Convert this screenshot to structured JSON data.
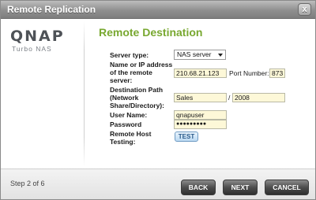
{
  "window": {
    "title": "Remote Replication",
    "close_glyph": "x"
  },
  "logo": {
    "brand": "QNAP",
    "sub": "Turbo NAS"
  },
  "heading": "Remote Destination",
  "form": {
    "server_type_label": "Server type:",
    "server_type_value": "NAS server",
    "address_label_1": "Name or IP address",
    "address_label_2": "of the remote",
    "address_label_3": "server:",
    "address_value": "210.68.21.123",
    "port_label": "Port Number:",
    "port_value": "873",
    "dest_label_1": "Destination Path",
    "dest_label_2": "(Network",
    "dest_label_3": "Share/Directory):",
    "dest_share_value": "Sales",
    "dest_separator": "/",
    "dest_dir_value": "2008",
    "username_label": "User Name:",
    "username_value": "qnapuser",
    "password_label": "Password",
    "password_value": "●●●●●●●●●",
    "remote_test_label_1": "Remote Host",
    "remote_test_label_2": "Testing:",
    "test_button": "TEST"
  },
  "footer": {
    "step": "Step 2 of 6",
    "back": "BACK",
    "next": "NEXT",
    "cancel": "CANCEL"
  },
  "icons": {
    "close": "close-icon",
    "dropdown": "chevron-down-icon"
  }
}
